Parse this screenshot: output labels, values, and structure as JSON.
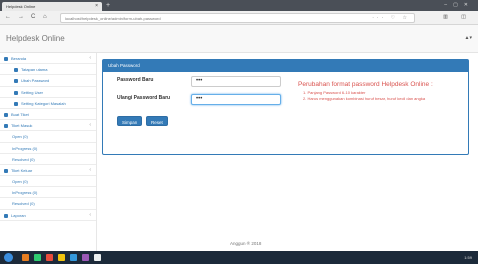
{
  "browser": {
    "tab_title": "Helpdesk Online",
    "tab_close": "×",
    "new_tab": "+",
    "url": "localhost/helpdesk_online/admin/form-ubah-password",
    "back": "←",
    "forward": "→",
    "reload": "C",
    "home": "⌂",
    "url_actions": "··· ♡ ☆",
    "toolbar_right": "▥ ◫"
  },
  "app": {
    "brand": "Helpdesk Online",
    "user_menu": "▲▾"
  },
  "sidebar": {
    "items": [
      {
        "label": "Beranda",
        "level": 1,
        "arrow": "‹"
      },
      {
        "label": "Tatapan utama",
        "level": 2,
        "arrow": ""
      },
      {
        "label": "Ubah Password",
        "level": 2,
        "arrow": ""
      },
      {
        "label": "Setting User",
        "level": 2,
        "arrow": ""
      },
      {
        "label": "Setting Kategori Masalah",
        "level": 2,
        "arrow": ""
      },
      {
        "label": "Buat Tiket",
        "level": 1,
        "arrow": ""
      },
      {
        "label": "Tiket Masuk",
        "level": 1,
        "arrow": "‹"
      },
      {
        "label": "Open (0)",
        "level": 3,
        "arrow": ""
      },
      {
        "label": "InProgress (0)",
        "level": 3,
        "arrow": ""
      },
      {
        "label": "Resolved (0)",
        "level": 3,
        "arrow": ""
      },
      {
        "label": "Tiket Keluar",
        "level": 1,
        "arrow": "‹"
      },
      {
        "label": "Open (0)",
        "level": 3,
        "arrow": ""
      },
      {
        "label": "InProgress (0)",
        "level": 3,
        "arrow": ""
      },
      {
        "label": "Resolved (0)",
        "level": 3,
        "arrow": ""
      },
      {
        "label": "Laporan",
        "level": 1,
        "arrow": "‹"
      }
    ]
  },
  "panel": {
    "heading": "Ubah Password",
    "new_password_label": "Password Baru",
    "new_password_value": "•••",
    "repeat_password_label": "Ulangi Password Baru",
    "repeat_password_value": "•••",
    "save_button": "Simpan",
    "reset_button": "Reset",
    "notice_title": "Perubahan format password Helpdesk Online :",
    "notice_1": "1. Panjang Password 6-10 karakter",
    "notice_2": "2. Harus menggunakan kombinasi huruf besar, huruf kecil dan angka"
  },
  "footer": {
    "text": "Anggun ® 2018"
  },
  "taskbar": {
    "clock": "1:59"
  },
  "colors": {
    "primary": "#337ab7",
    "notice": "#d9534f"
  }
}
